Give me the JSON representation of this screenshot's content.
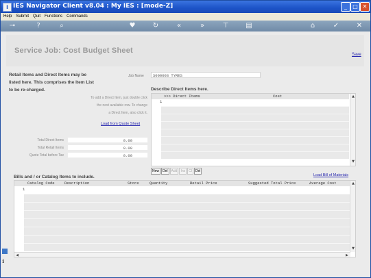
{
  "window": {
    "title": "IES Navigator Client v8.04 : My IES :      [mode-Z]",
    "controls": {
      "minimize": "_",
      "maximize": "□",
      "close": "✕"
    }
  },
  "menu": [
    "Help",
    "Submit",
    "Quit",
    "Functions",
    "Commands"
  ],
  "toolbar_icons": [
    "key-icon",
    "help-icon",
    "search-icon",
    "heart-icon",
    "refresh-icon",
    "back-icon",
    "forward-icon",
    "filter-icon",
    "document-icon",
    "home-icon",
    "check-icon",
    "cancel-icon"
  ],
  "page": {
    "title": "Service Job: Cost Budget Sheet",
    "save_label": "Save"
  },
  "left_panel": {
    "intro_lines": [
      "Retail Items and Direct Items may be",
      "listed here. This comprises the Item List",
      "to be re-charged."
    ],
    "help_lines": [
      "To add a Direct Item, just double click",
      "the next available row. To change",
      "a Direct Item, also click it."
    ],
    "load_quote_label": "Load from Quote Sheet",
    "total_direct_label": "Total Direct Items",
    "total_direct_value": "0.00",
    "total_retail_label": "Total Retail Items",
    "total_retail_value": "0.00",
    "quote_total_label": "Quote Total before Tax",
    "quote_total_value": "0.00"
  },
  "job": {
    "label": "Job Name",
    "value": "S000003 TYRES"
  },
  "direct_items": {
    "heading": "Describe Direct Items here.",
    "columns": [
      ">>> Direct Items",
      "Cost"
    ],
    "row_number": "1"
  },
  "nav_buttons": [
    {
      "label": "New",
      "enabled": true
    },
    {
      "label": "Del",
      "enabled": true
    },
    {
      "label": "Add",
      "enabled": false
    },
    {
      "label": "Ins",
      "enabled": false
    },
    {
      "label": "Cl",
      "enabled": false
    },
    {
      "label": "Del",
      "enabled": true
    }
  ],
  "bills": {
    "heading": "Bills and / or Catalog Items to include.",
    "load_bom_label": "Load Bill of Materials",
    "columns": [
      "Catalog Code",
      "Description",
      "Store",
      "Quantity",
      "Retail Price",
      "Suggested Total Price",
      "Average Cost"
    ],
    "row_number": "1"
  },
  "scroll_arrows": {
    "up": "▲",
    "down": "▼",
    "left": "◀",
    "right": "▶"
  }
}
